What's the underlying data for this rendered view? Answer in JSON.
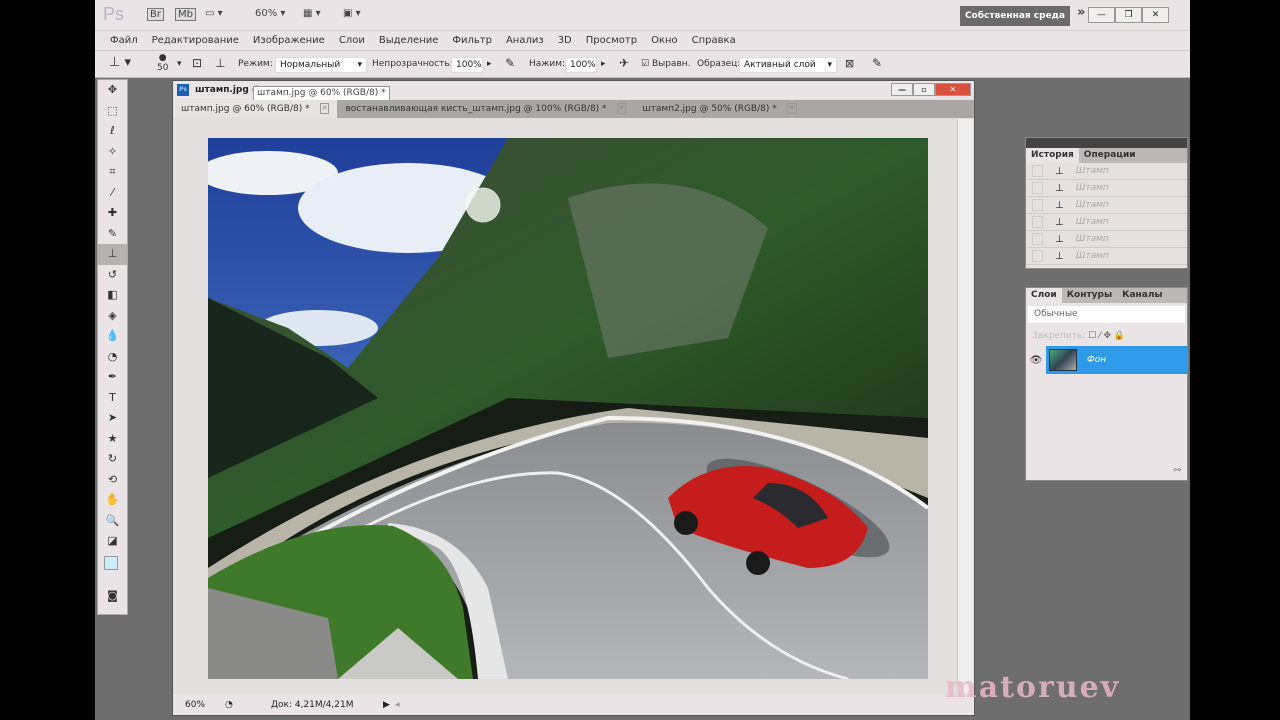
{
  "appbar": {
    "logo": "Ps",
    "bridge": "Br",
    "minibridge": "Mb",
    "zoom": "60%",
    "workspace": "Собственная среда",
    "more": "»"
  },
  "menu": [
    "Файл",
    "Редактирование",
    "Изображение",
    "Слои",
    "Выделение",
    "Фильтр",
    "Анализ",
    "3D",
    "Просмотр",
    "Окно",
    "Справка"
  ],
  "options": {
    "brush_size": "50",
    "mode_label": "Режим:",
    "mode_value": "Нормальный",
    "opacity_label": "Непрозрачность:",
    "opacity_value": "100%",
    "flow_label": "Нажим:",
    "flow_value": "100%",
    "aligned_label": "Выравн.",
    "aligned_checked": true,
    "sample_label": "Образец:",
    "sample_value": "Активный слой"
  },
  "document": {
    "title": "штамп.jpg @",
    "tooltip": "штамп.jpg @ 60% (RGB/8) *",
    "tabs": [
      {
        "label": "штамп.jpg @ 60% (RGB/8) *",
        "active": true
      },
      {
        "label": "востанавливающая кисть_штамп.jpg @ 100% (RGB/8) *",
        "active": false
      },
      {
        "label": "штамп2.jpg @ 50% (RGB/8) *",
        "active": false
      }
    ],
    "status_zoom": "60%",
    "status_doc": "Док: 4,21M/4,21M"
  },
  "history": {
    "tabs": [
      "История",
      "Операции"
    ],
    "items": [
      "Штамп",
      "Штамп",
      "Штамп",
      "Штамп",
      "Штамп",
      "Штамп"
    ]
  },
  "layers": {
    "tabs": [
      "Слои",
      "Контуры",
      "Каналы"
    ],
    "blend": "Обычные",
    "lock_label": "Закрепить:",
    "items": [
      {
        "name": "Фон",
        "selected": true
      }
    ]
  },
  "colors": {
    "selection": "#2f9ae8",
    "workspace_btn": "#6a6a6a"
  },
  "watermark": "matoruev"
}
